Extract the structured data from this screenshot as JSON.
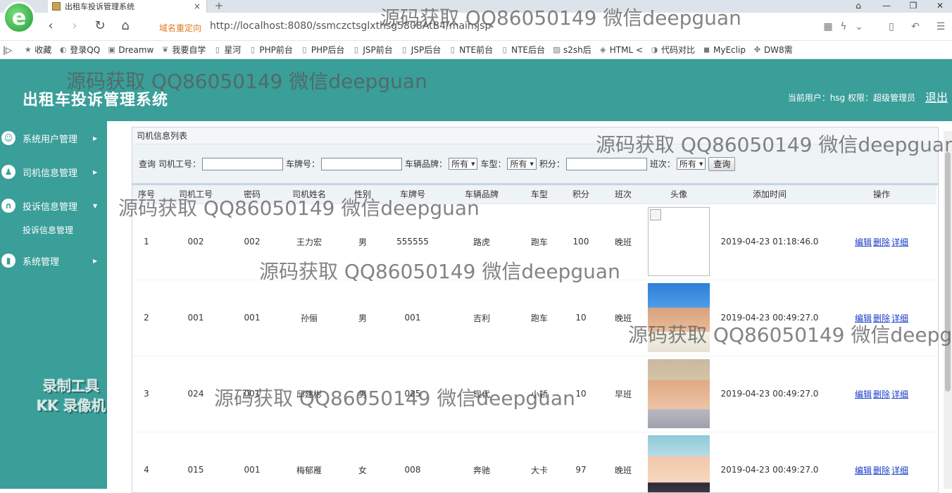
{
  "browser": {
    "tab_title": "出租车投诉管理系统",
    "tab_close": "×",
    "new_tab": "+",
    "redirect_label": "域名重定向",
    "url": "http://localhost:8080/ssmczctsglxthsg5808AtB4/main.jsp",
    "bookmarks": [
      {
        "label": "收藏",
        "icon": "star-icon"
      },
      {
        "label": "登录QQ",
        "icon": "google-icon"
      },
      {
        "label": "Dreamw",
        "icon": "dreamweaver-icon"
      },
      {
        "label": "我要自学",
        "icon": "leaf-icon"
      },
      {
        "label": "星河",
        "icon": "page-icon"
      },
      {
        "label": "PHP前台",
        "icon": "page-icon"
      },
      {
        "label": "PHP后台",
        "icon": "page-icon"
      },
      {
        "label": "JSP前台",
        "icon": "page-icon"
      },
      {
        "label": "JSP后台",
        "icon": "page-icon"
      },
      {
        "label": "NTE前台",
        "icon": "page-icon"
      },
      {
        "label": "NTE后台",
        "icon": "page-icon"
      },
      {
        "label": "s2sh后",
        "icon": "image-icon"
      },
      {
        "label": "HTML <",
        "icon": "html-icon"
      },
      {
        "label": "代码对比",
        "icon": "compare-icon"
      },
      {
        "label": "MyEclip",
        "icon": "eclipse-icon"
      },
      {
        "label": "DW8需",
        "icon": "paw-icon"
      }
    ]
  },
  "header": {
    "title": "出租车投诉管理系统",
    "user_info": "当前用户：hsg  权限：超级管理员",
    "logout": "退出"
  },
  "sidebar": {
    "items": [
      {
        "label": "系统用户管理",
        "icon": "user-icon",
        "arrow": "▶"
      },
      {
        "label": "司机信息管理",
        "icon": "driver-icon",
        "arrow": "▶"
      },
      {
        "label": "投诉信息管理",
        "icon": "complaint-icon",
        "arrow": "▼"
      },
      {
        "label": "系统管理",
        "icon": "chart-icon",
        "arrow": "▶"
      }
    ],
    "submenu": "投诉信息管理",
    "recorder_line1": "录制工具",
    "recorder_line2": "KK 录像机"
  },
  "panel": {
    "title": "司机信息列表"
  },
  "search": {
    "prefix": "查询",
    "driver_no_label": "司机工号：",
    "plate_label": "车牌号：",
    "brand_label": "车辆品牌：",
    "brand_value": "所有",
    "type_label": "车型：",
    "type_value": "所有",
    "score_label": "积分：",
    "shift_label": "班次：",
    "shift_value": "所有",
    "button": "查询"
  },
  "table": {
    "columns": [
      "序号",
      "司机工号",
      "密码",
      "司机姓名",
      "性别",
      "车牌号",
      "车辆品牌",
      "车型",
      "积分",
      "班次",
      "头像",
      "添加时间",
      "操作"
    ],
    "rows": [
      {
        "no": "1",
        "driver_no": "002",
        "password": "002",
        "name": "王力宏",
        "gender": "男",
        "plate": "555555",
        "brand": "路虎",
        "type": "跑车",
        "score": "100",
        "shift": "晚班",
        "avatar": "broken",
        "time": "2019-04-23 01:18:46.0"
      },
      {
        "no": "2",
        "driver_no": "001",
        "password": "001",
        "name": "孙俪",
        "gender": "男",
        "plate": "001",
        "brand": "吉利",
        "type": "跑车",
        "score": "10",
        "shift": "晚班",
        "avatar": "photo-woman-1",
        "time": "2019-04-23 00:49:27.0"
      },
      {
        "no": "3",
        "driver_no": "024",
        "password": "001",
        "name": "邱建彬",
        "gender": "男",
        "plate": "025",
        "brand": "现代",
        "type": "小轿",
        "score": "10",
        "shift": "早班",
        "avatar": "photo-man-1",
        "time": "2019-04-23 00:49:27.0"
      },
      {
        "no": "4",
        "driver_no": "015",
        "password": "001",
        "name": "梅郁雁",
        "gender": "女",
        "plate": "008",
        "brand": "奔驰",
        "type": "大卡",
        "score": "97",
        "shift": "晚班",
        "avatar": "photo-woman-2",
        "time": "2019-04-23 00:49:27.0"
      }
    ],
    "actions": [
      "编辑",
      "删除",
      "详细"
    ]
  },
  "watermark": "源码获取 QQ86050149 微信deepguan"
}
